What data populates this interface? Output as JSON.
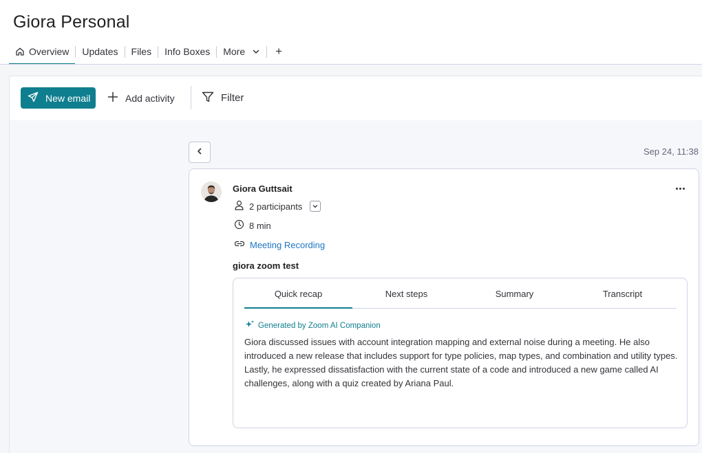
{
  "page": {
    "title": "Giora Personal"
  },
  "tabs": {
    "overview": "Overview",
    "updates": "Updates",
    "files": "Files",
    "info_boxes": "Info Boxes",
    "more": "More",
    "add": "+"
  },
  "toolbar": {
    "new_email": "New email",
    "add_activity": "Add activity",
    "filter": "Filter"
  },
  "activity": {
    "timestamp": "Sep 24, 11:38",
    "author": "Giora Guttsait",
    "participants": "2 participants",
    "duration": "8 min",
    "recording_link": "Meeting Recording",
    "meeting_title": "giora zoom test"
  },
  "recap": {
    "tabs": [
      "Quick recap",
      "Next steps",
      "Summary",
      "Transcript"
    ],
    "ai_label": "Generated by Zoom AI Companion",
    "text": "Giora discussed issues with account integration mapping and external noise during a meeting. He also introduced a new release that includes support for type policies, map types, and combination and utility types. Lastly, he expressed dissatisfaction with the current state of a code and introduced a new game called AI challenges, along with a quiz created by Ariana Paul."
  },
  "colors": {
    "accent": "#0f7e8e",
    "link": "#1f76c2",
    "border": "#d0d4e4"
  },
  "icons": [
    "home-icon",
    "chevron-down-icon",
    "send-icon",
    "plus-icon",
    "filter-icon",
    "chevron-left-icon",
    "more-icon",
    "person-icon",
    "clock-icon",
    "link-icon",
    "sparkle-icon"
  ]
}
